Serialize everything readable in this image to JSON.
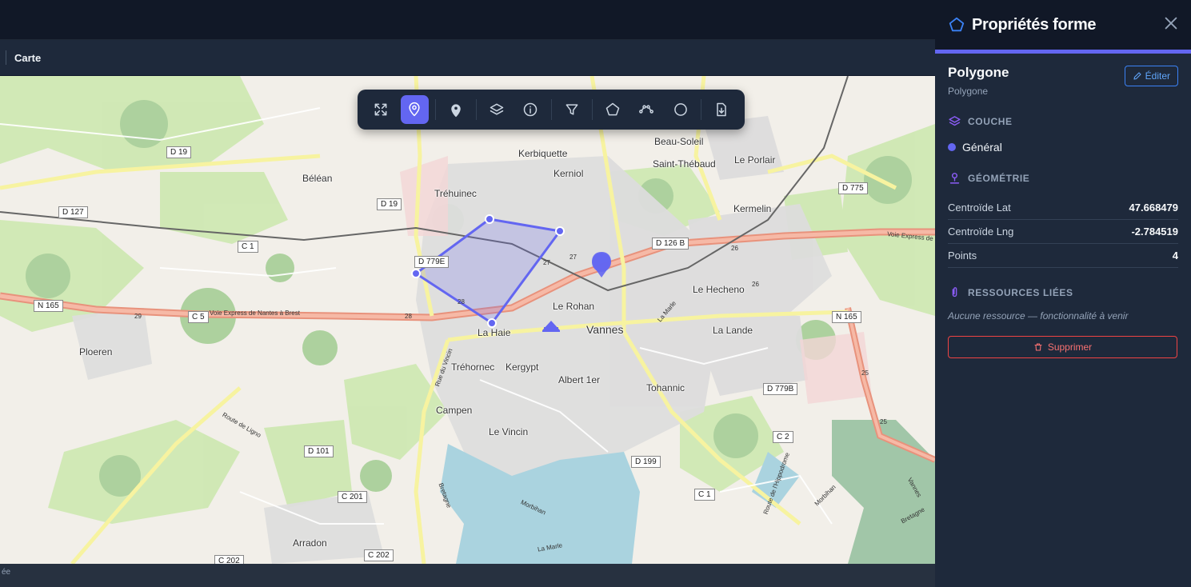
{
  "header": {
    "section_title": "Carte"
  },
  "toolbar": {
    "tools": [
      {
        "name": "fullscreen-icon",
        "active": false
      },
      {
        "name": "location-pin-icon",
        "active": true
      },
      {
        "name": "marker-icon",
        "active": false
      },
      {
        "name": "layers-icon",
        "active": false
      },
      {
        "name": "info-icon",
        "active": false
      },
      {
        "name": "filter-icon",
        "active": false
      },
      {
        "name": "polygon-icon",
        "active": false
      },
      {
        "name": "polyline-icon",
        "active": false
      },
      {
        "name": "circle-icon",
        "active": false
      },
      {
        "name": "export-file-icon",
        "active": false
      }
    ]
  },
  "map": {
    "places": [
      "Béléan",
      "Tréhuinec",
      "Kerbiquette",
      "Kerniol",
      "Beau-Soleil",
      "Saint-Thébaud",
      "Le Porlair",
      "Kermelin",
      "Le Hecheno",
      "Le Rohan",
      "Vannes",
      "La Haie",
      "La Lande",
      "Ploeren",
      "Tréhornec",
      "Kergypt",
      "Albert 1er",
      "Tohannic",
      "Campen",
      "Le Vincin",
      "Arradon"
    ],
    "roads": [
      "D 19",
      "D 19",
      "D 127",
      "C 1",
      "D 779E",
      "N 165",
      "C 5",
      "D 775",
      "D 126 B",
      "N 165",
      "D 779B",
      "C 2",
      "D 101",
      "D 199",
      "C 201",
      "C 1",
      "C 202",
      "C 202"
    ],
    "road_names": [
      "Voie Express de Nantes à Brest",
      "Voie Express de",
      "Rue du Vincin",
      "Route de Ligno",
      "Bretagne",
      "Morbihan",
      "La Marle",
      "Route de l'Hippodrome",
      "Morbihan",
      "Bretagne",
      "Vannes",
      "La Marle"
    ],
    "kilometer_marks": [
      "29",
      "28",
      "28",
      "27",
      "27",
      "26",
      "26",
      "25",
      "25"
    ],
    "attribution": "ée"
  },
  "panel": {
    "title": "Propriétés forme",
    "shape_name": "Polygone",
    "shape_type": "Polygone",
    "edit_label": "Éditer",
    "layer_heading": "COUCHE",
    "layer_name": "Général",
    "layer_color": "#6366f1",
    "geometry_heading": "GÉOMÉTRIE",
    "geometry": [
      {
        "label": "Centroïde Lat",
        "value": "47.668479"
      },
      {
        "label": "Centroïde Lng",
        "value": "-2.784519"
      },
      {
        "label": "Points",
        "value": "4"
      }
    ],
    "resources_heading": "RESSOURCES LIÉES",
    "resources_empty": "Aucune ressource — fonctionnalité à venir",
    "delete_label": "Supprimer"
  }
}
